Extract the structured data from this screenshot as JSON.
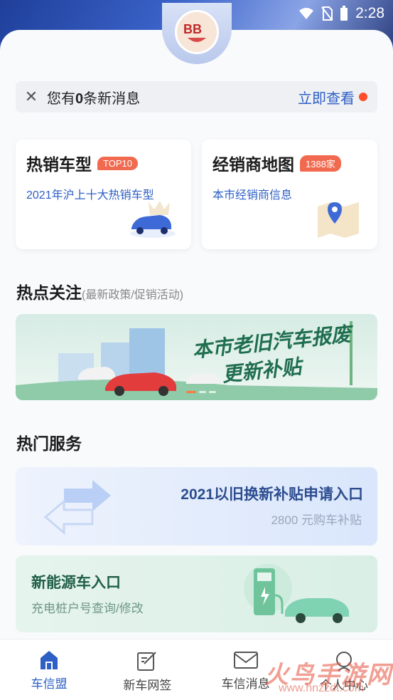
{
  "status": {
    "time": "2:28"
  },
  "message_bar": {
    "prefix": "您有",
    "count": "0",
    "suffix": "条新消息",
    "link": "立即查看"
  },
  "cards": [
    {
      "title": "热销车型",
      "badge": "TOP10",
      "subtitle": "2021年沪上十大热销车型"
    },
    {
      "title": "经销商地图",
      "badge": "1388家",
      "subtitle": "本市经销商信息"
    }
  ],
  "hot_focus": {
    "title": "热点关注",
    "hint": "(最新政策/促销活动)"
  },
  "banner": {
    "line1": "本市老旧汽车报废",
    "line2": "更新补贴"
  },
  "hot_services": {
    "title": "热门服务"
  },
  "services": [
    {
      "title": "2021以旧换新补贴申请入口",
      "subtitle": "2800 元购车补贴"
    },
    {
      "title": "新能源车入口",
      "subtitle": "充电桩户号查询/修改"
    }
  ],
  "tabs": [
    {
      "label": "车信盟",
      "icon": "home-icon",
      "active": true
    },
    {
      "label": "新车网签",
      "icon": "edit-icon"
    },
    {
      "label": "车信消息",
      "icon": "mail-icon"
    },
    {
      "label": "个人中心",
      "icon": "user-icon"
    }
  ],
  "watermark": {
    "text": "火鸟手游网",
    "url": "www.hnzzdt.com"
  },
  "colors": {
    "accent": "#2d5fc4",
    "badge": "#f16a4f",
    "dot": "#ff4d2a"
  }
}
